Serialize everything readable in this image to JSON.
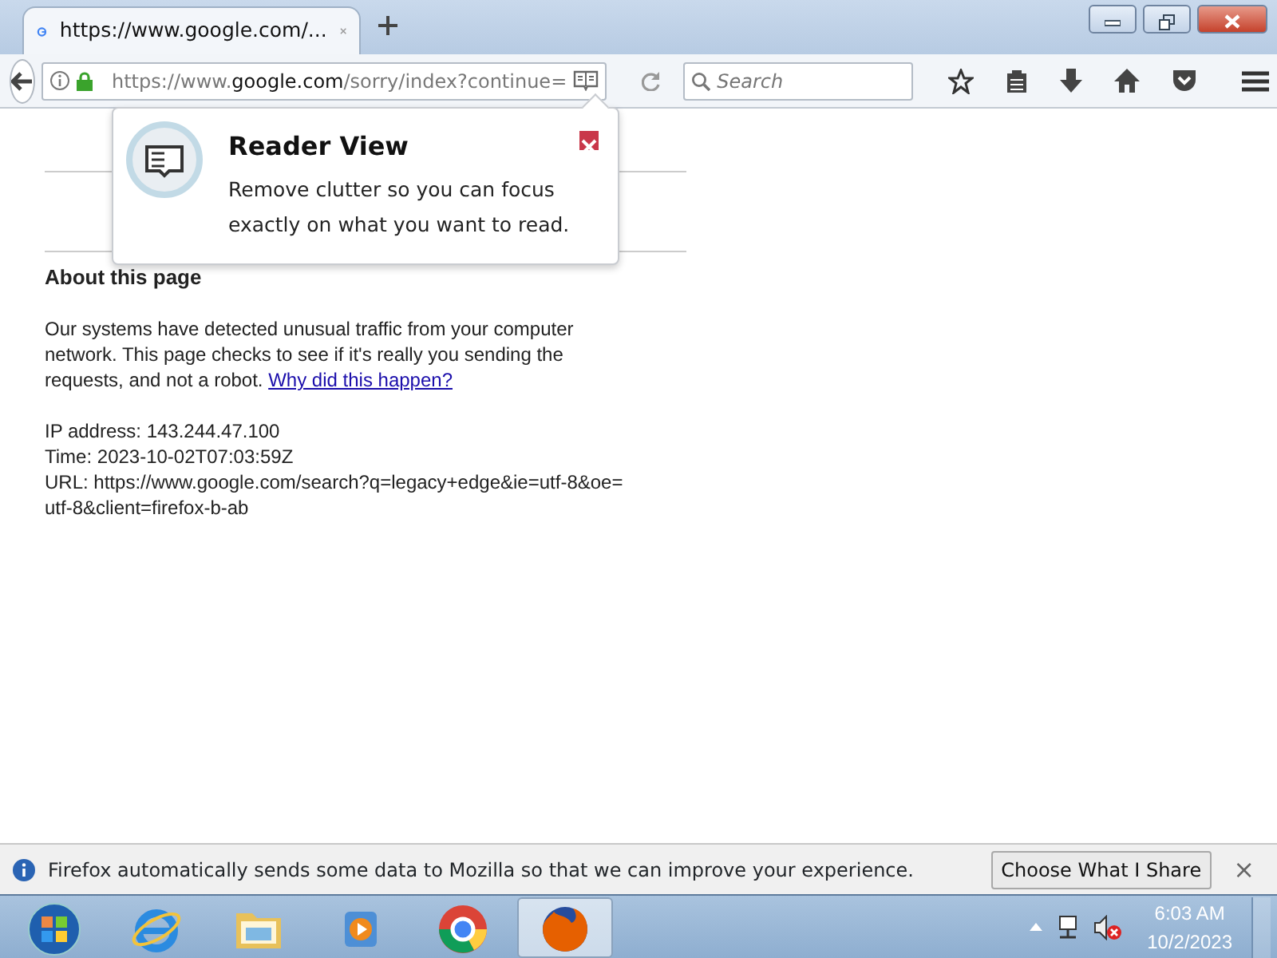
{
  "tabs": [
    {
      "title": "https://www.google.com/...",
      "selected": true
    }
  ],
  "address_bar": {
    "prefix": "https://www.",
    "host": "google.com",
    "path": "/sorry/index?continue="
  },
  "search": {
    "placeholder": "Search"
  },
  "popup": {
    "title": "Reader View",
    "text": "Remove clutter so you can focus exactly on what you want to read."
  },
  "page": {
    "heading": "About this page",
    "paragraph": "Our systems have detected unusual traffic from your computer network. This page checks to see if it's really you sending the requests, and not a robot.",
    "link": "Why did this happen?",
    "details": [
      "IP address: 143.244.47.100",
      "Time: 2023-10-02T07:03:59Z",
      "URL: https://www.google.com/search?q=legacy+edge&ie=utf-8&oe=utf-8&client=firefox-b-ab"
    ]
  },
  "notification": {
    "text": "Firefox automatically sends some data to Mozilla so that we can improve your experience.",
    "button": "Choose What I Share",
    "close": "×"
  },
  "taskbar": {
    "apps": [
      {
        "kind": "start",
        "selected": false
      },
      {
        "kind": "ie",
        "selected": false
      },
      {
        "kind": "folder",
        "selected": false
      },
      {
        "kind": "media",
        "selected": false
      },
      {
        "kind": "chrome",
        "selected": false
      },
      {
        "kind": "firefox",
        "selected": true
      }
    ],
    "time": "6:03 AM",
    "date": "10/2/2023"
  }
}
